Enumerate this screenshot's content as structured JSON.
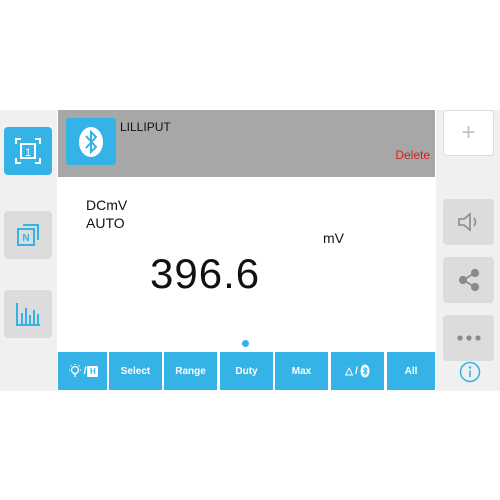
{
  "device": {
    "name": "LILLIPUT",
    "delete_label": "Delete"
  },
  "display": {
    "mode": "DCmV",
    "range_mode": "AUTO",
    "unit": "mV",
    "reading": "396.6"
  },
  "left_bar": {
    "items": [
      {
        "icon": "channel-1-icon",
        "label": "1",
        "active": true
      },
      {
        "icon": "channel-n-icon",
        "label": "N",
        "active": false
      },
      {
        "icon": "bar-chart-icon",
        "label": "",
        "active": false
      }
    ]
  },
  "right_bar": {
    "items": [
      {
        "icon": "plus-icon",
        "label": "+"
      },
      {
        "icon": "speaker-icon"
      },
      {
        "icon": "share-icon"
      },
      {
        "icon": "more-icon"
      },
      {
        "icon": "info-icon"
      }
    ]
  },
  "button_bar": {
    "backlight_hold": {
      "icon": "lightbulb-icon",
      "sep": "/",
      "hold_letter": "H"
    },
    "select": "Select",
    "range": "Range",
    "duty": "Duty",
    "max": "Max",
    "delta_bt": {
      "delta": "△",
      "sep": "/",
      "icon": "bluetooth-icon"
    },
    "all": "All"
  },
  "colors": {
    "accent": "#35b3e6",
    "header_bg": "#a7a7a7",
    "delete_red": "#d81e1e",
    "sidebar_bg": "#f0f0f0"
  }
}
